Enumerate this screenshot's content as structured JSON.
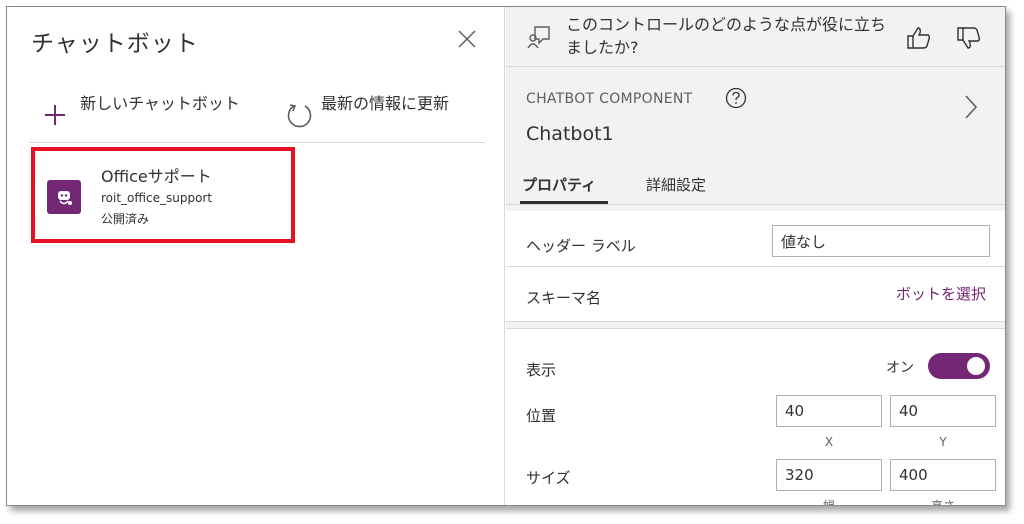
{
  "left_panel": {
    "title": "チャットボット",
    "close_icon": "close-icon",
    "toolbar": {
      "new_bot": {
        "icon": "plus-icon",
        "label": "新しいチャットボット"
      },
      "refresh": {
        "icon": "refresh-icon",
        "label": "最新の情報に更新"
      }
    },
    "bots": [
      {
        "icon": "bot-icon",
        "name": "Officeサポート",
        "schema": "roit_office_support",
        "status": "公開済み"
      }
    ],
    "highlight_color": "#e81123"
  },
  "right_panel": {
    "feedback": {
      "icon": "feedback-chat-icon",
      "question": "このコントロールのどのような点が役に立ちましたか?",
      "thumbs_up_icon": "thumbs-up-icon",
      "thumbs_down_icon": "thumbs-down-icon"
    },
    "component": {
      "type_label": "CHATBOT COMPONENT",
      "help_icon": "help-icon",
      "expand_icon": "chevron-right-icon",
      "name": "Chatbot1"
    },
    "tabs": [
      {
        "label": "プロパティ",
        "active": true
      },
      {
        "label": "詳細設定",
        "active": false
      }
    ],
    "properties": {
      "header_label": {
        "label": "ヘッダー ラベル",
        "value": "値なし"
      },
      "schema_name": {
        "label": "スキーマ名",
        "link": "ボットを選択"
      },
      "visible": {
        "label": "表示",
        "toggle_label": "オン",
        "on": true
      },
      "position": {
        "label": "位置",
        "x": "40",
        "y": "40",
        "x_label": "X",
        "y_label": "Y"
      },
      "size": {
        "label": "サイズ",
        "width": "320",
        "height": "400",
        "width_label": "幅",
        "height_label": "高さ"
      }
    },
    "accent_color": "#742774"
  }
}
